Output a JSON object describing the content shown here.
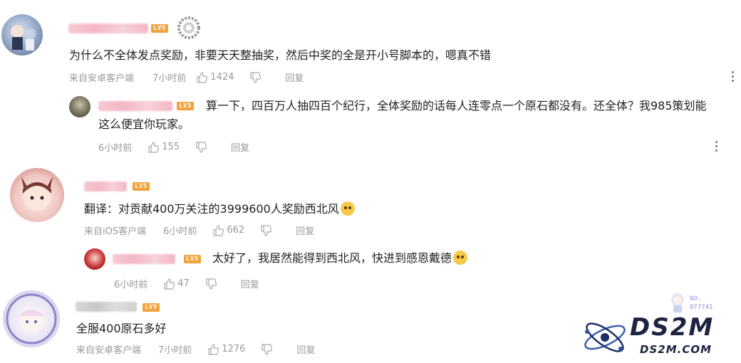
{
  "comments": [
    {
      "level": "LV5",
      "text": "为什么不全体发点奖励，非要天天整抽奖，然后中奖的全是开小号脚本的，嗯真不错",
      "source": "来自安卓客户端",
      "time": "7小时前",
      "likes": "1424",
      "reply_label": "回复",
      "reply": {
        "level": "LV5",
        "text_line1": "算一下，四百万人抽四百个纪行，全体奖励的话每人连零点一个原石都没有。还全体？我985策划能",
        "text_line2": "这么便宜你玩家。",
        "time": "6小时前",
        "likes": "155",
        "reply_label": "回复"
      }
    },
    {
      "level": "LV5",
      "text": "翻译：对贡献400万关注的3999600人奖励西北风",
      "source": "来自iOS客户端",
      "time": "6小时前",
      "likes": "662",
      "reply_label": "回复",
      "reply": {
        "level": "LV5",
        "text": "太好了，我居然能得到西北风，快进到感恩戴德",
        "time": "6小时前",
        "likes": "47",
        "reply_label": "回复"
      }
    },
    {
      "level": "LV5",
      "text": "全服400原石多好",
      "source": "来自安卓客户端",
      "time": "7小时前",
      "likes": "1276",
      "reply_label": "回复"
    }
  ],
  "watermark": {
    "brand": "DS2M",
    "url": "DS2M.COM",
    "badge": "NO.\n077741"
  },
  "colors": {
    "level_badge": "#f1a23b",
    "meta_text": "#999999",
    "name_blur": "#f3b6c4"
  }
}
